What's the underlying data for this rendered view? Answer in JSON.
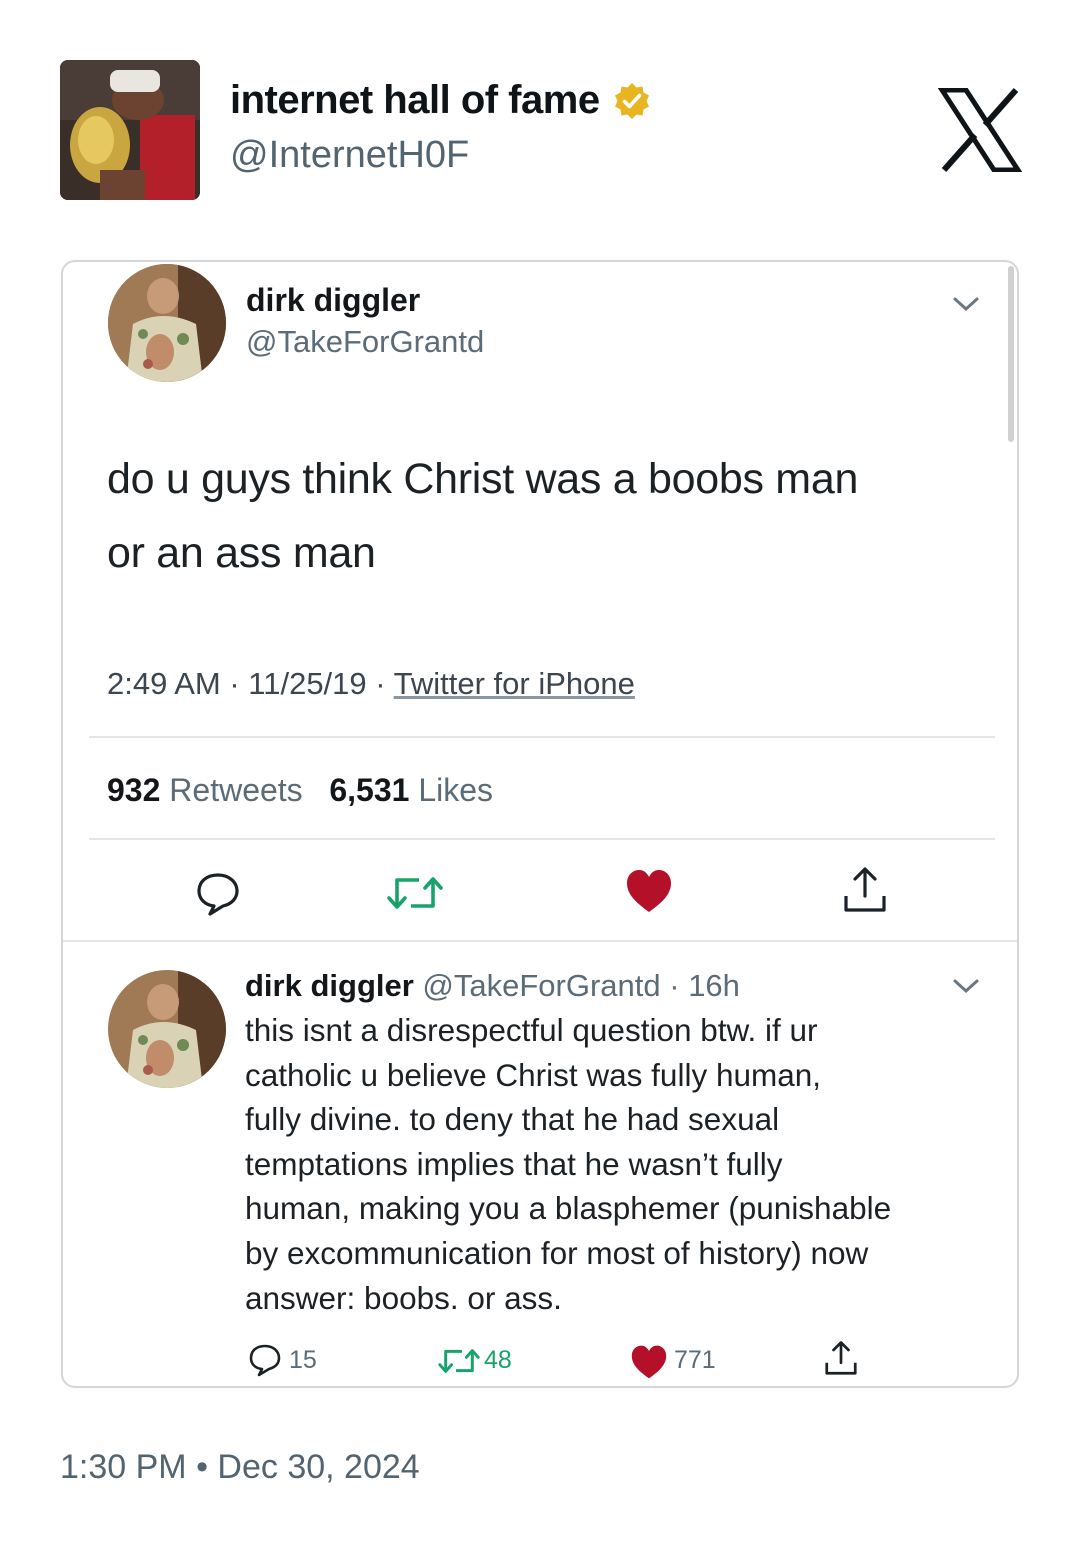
{
  "outer_tweet": {
    "author_name": "internet hall of fame",
    "author_handle": "@InternetH0F",
    "timestamp": "1:30 PM • Dec 30, 2024",
    "icons": [
      "avatar",
      "verified-badge-icon",
      "x-logo-icon"
    ]
  },
  "quoted_tweet": {
    "author_name": "dirk diggler",
    "author_handle": "@TakeForGrantd",
    "text_line1": "do u guys think Christ was a boobs man",
    "text_line2": "or an ass man",
    "meta_time_date": "2:49 AM · 11/25/19 · ",
    "meta_source": "Twitter for iPhone",
    "retweets_count": "932",
    "retweets_label": " Retweets",
    "likes_count": "6,531",
    "likes_label": " Likes",
    "actions": [
      "reply-icon",
      "retweet-icon",
      "like-icon",
      "share-icon"
    ],
    "like_color": "#b5102a"
  },
  "reply_tweet": {
    "author_name": "dirk diggler",
    "author_handle": " @TakeForGrantd · 16h",
    "lines": [
      "this isnt a disrespectful question btw. if ur",
      "catholic u believe Christ was fully human,",
      "fully divine. to deny that he had sexual",
      "temptations implies that he wasn’t fully",
      "human, making you a blasphemer (punishable",
      "by excommunication for most of history) now",
      "answer: boobs. or ass."
    ],
    "reply_count": "15",
    "retweet_count": "48",
    "like_count": "771"
  }
}
